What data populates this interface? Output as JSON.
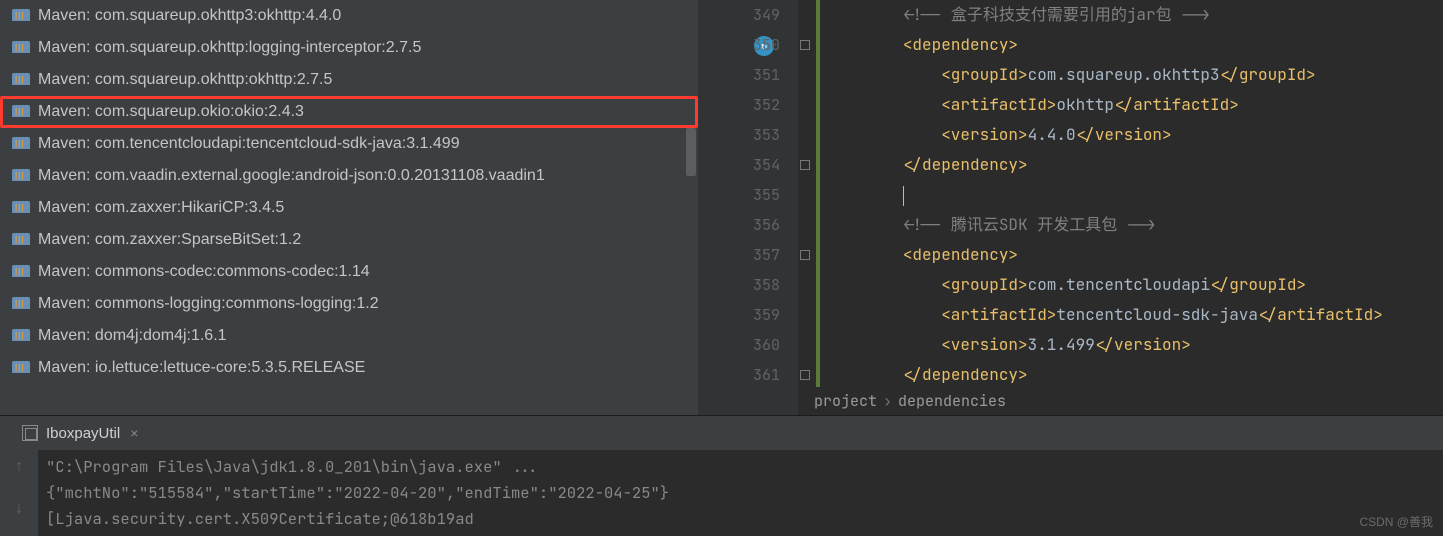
{
  "projectTree": {
    "libs": [
      {
        "label": "Maven: com.squareup.okhttp3:okhttp:4.4.0",
        "hl": false
      },
      {
        "label": "Maven: com.squareup.okhttp:logging-interceptor:2.7.5",
        "hl": false
      },
      {
        "label": "Maven: com.squareup.okhttp:okhttp:2.7.5",
        "hl": false
      },
      {
        "label": "Maven: com.squareup.okio:okio:2.4.3",
        "hl": true
      },
      {
        "label": "Maven: com.tencentcloudapi:tencentcloud-sdk-java:3.1.499",
        "hl": false
      },
      {
        "label": "Maven: com.vaadin.external.google:android-json:0.0.20131108.vaadin1",
        "hl": false
      },
      {
        "label": "Maven: com.zaxxer:HikariCP:3.4.5",
        "hl": false
      },
      {
        "label": "Maven: com.zaxxer:SparseBitSet:1.2",
        "hl": false
      },
      {
        "label": "Maven: commons-codec:commons-codec:1.14",
        "hl": false
      },
      {
        "label": "Maven: commons-logging:commons-logging:1.2",
        "hl": false
      },
      {
        "label": "Maven: dom4j:dom4j:1.6.1",
        "hl": false
      },
      {
        "label": "Maven: io.lettuce:lettuce-core:5.3.5.RELEASE",
        "hl": false
      }
    ]
  },
  "editor": {
    "startLine": 349,
    "lines": [
      {
        "n": 349,
        "segs": [
          [
            "        ",
            ""
          ],
          [
            "<!-- 盒子科技支付需要引用的jar包 -->",
            "cm"
          ]
        ]
      },
      {
        "n": 350,
        "segs": [
          [
            "        ",
            ""
          ],
          [
            "<dependency>",
            "tag"
          ]
        ]
      },
      {
        "n": 351,
        "segs": [
          [
            "            ",
            ""
          ],
          [
            "<groupId>",
            "tag"
          ],
          [
            "com.squareup.okhttp3",
            "txt"
          ],
          [
            "</groupId>",
            "tag"
          ]
        ]
      },
      {
        "n": 352,
        "segs": [
          [
            "            ",
            ""
          ],
          [
            "<artifactId>",
            "tag"
          ],
          [
            "okhttp",
            "txt"
          ],
          [
            "</artifactId>",
            "tag"
          ]
        ]
      },
      {
        "n": 353,
        "segs": [
          [
            "            ",
            ""
          ],
          [
            "<version>",
            "tag"
          ],
          [
            "4.4.0",
            "txt"
          ],
          [
            "</version>",
            "tag"
          ]
        ]
      },
      {
        "n": 354,
        "segs": [
          [
            "        ",
            ""
          ],
          [
            "</dependency>",
            "tag"
          ]
        ]
      },
      {
        "n": 355,
        "segs": [
          [
            "        ",
            ""
          ]
        ],
        "caret": true
      },
      {
        "n": 356,
        "segs": [
          [
            "        ",
            ""
          ],
          [
            "<!-- 腾讯云SDK 开发工具包 -->",
            "cm"
          ]
        ]
      },
      {
        "n": 357,
        "segs": [
          [
            "        ",
            ""
          ],
          [
            "<dependency>",
            "tag"
          ]
        ]
      },
      {
        "n": 358,
        "segs": [
          [
            "            ",
            ""
          ],
          [
            "<groupId>",
            "tag"
          ],
          [
            "com.tencentcloudapi",
            "txt"
          ],
          [
            "</groupId>",
            "tag"
          ]
        ]
      },
      {
        "n": 359,
        "segs": [
          [
            "            ",
            ""
          ],
          [
            "<artifactId>",
            "tag"
          ],
          [
            "tencentcloud-sdk-java",
            "txt"
          ],
          [
            "</artifactId>",
            "tag"
          ]
        ]
      },
      {
        "n": 360,
        "segs": [
          [
            "            ",
            ""
          ],
          [
            "<version>",
            "tag"
          ],
          [
            "3.1.499",
            "txt"
          ],
          [
            "</version>",
            "tag"
          ]
        ]
      },
      {
        "n": 361,
        "segs": [
          [
            "        ",
            ""
          ],
          [
            "</dependency>",
            "tag"
          ]
        ]
      }
    ],
    "breadcrumbs": [
      "project",
      "dependencies"
    ]
  },
  "console": {
    "tab": "IboxpayUtil",
    "lines": [
      "\"C:\\Program Files\\Java\\jdk1.8.0_201\\bin\\java.exe\" ...",
      "{\"mchtNo\":\"515584\",\"startTime\":\"2022-04-20\",\"endTime\":\"2022-04-25\"}",
      "[Ljava.security.cert.X509Certificate;@618b19ad"
    ]
  },
  "watermark": "CSDN @善我"
}
